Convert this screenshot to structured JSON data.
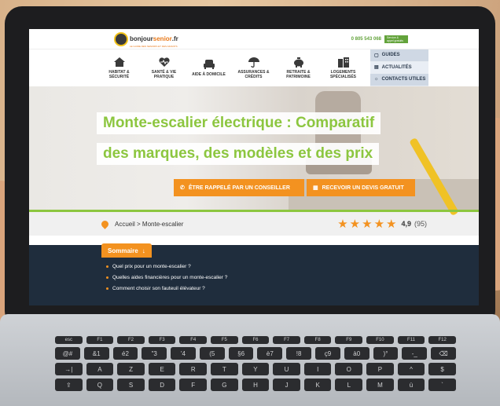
{
  "site": {
    "logo_name": "bonjour",
    "logo_name_accent": "senior",
    "logo_tld": ".fr",
    "logo_tagline": "LE GUIDE DES SENIORS ET DES AIDANTS",
    "phone": "0 805 543 068",
    "phone_badge": "Service & appel gratuits"
  },
  "nav": [
    {
      "label": "HABITAT & SÉCURITÉ",
      "icon": "house-icon"
    },
    {
      "label": "SANTÉ & VIE PRATIQUE",
      "icon": "heart-pulse-icon"
    },
    {
      "label": "AIDE À DOMICILE",
      "icon": "armchair-icon"
    },
    {
      "label": "ASSURANCES & CRÉDITS",
      "icon": "umbrella-icon"
    },
    {
      "label": "RETRAITE & PATRIMOINE",
      "icon": "piggy-bank-icon"
    },
    {
      "label": "LOGEMENTS SPÉCIALISÉS",
      "icon": "building-icon"
    }
  ],
  "side_menu": [
    {
      "label": "GUIDES",
      "icon": "book-icon"
    },
    {
      "label": "ACTUALITÉS",
      "icon": "newspaper-icon"
    },
    {
      "label": "CONTACTS UTILES",
      "icon": "lightbulb-icon"
    }
  ],
  "hero": {
    "title_line1": "Monte-escalier électrique : Comparatif",
    "title_line2": "des marques, des modèles et des prix",
    "cta_callback": "ÊTRE RAPPELÉ PAR UN CONSEILLER",
    "cta_quote": "RECEVOIR UN DEVIS GRATUIT"
  },
  "breadcrumb": {
    "text": "Accueil > Monte-escalier"
  },
  "rating": {
    "value": 4.9,
    "display": "4,9",
    "count": "(95)",
    "stars": 5
  },
  "summary": {
    "tab_label": "Sommaire",
    "items": [
      "Quel prix pour un monte-escalier ?",
      "Quelles aides financières pour un monte-escalier ?",
      "Comment choisir son fauteuil élévateur ?"
    ]
  },
  "keyboard": {
    "fn_row": [
      "esc",
      "F1",
      "F2",
      "F3",
      "F4",
      "F5",
      "F6",
      "F7",
      "F8",
      "F9",
      "F10",
      "F11",
      "F12"
    ],
    "num_row": [
      "@#",
      "&1",
      "é2",
      "\"3",
      "'4",
      "(5",
      "§6",
      "è7",
      "!8",
      "ç9",
      "à0",
      ")°",
      "-_",
      "⌫"
    ],
    "row_a": [
      "→|",
      "A",
      "Z",
      "E",
      "R",
      "T",
      "Y",
      "U",
      "I",
      "O",
      "P",
      "^",
      "$"
    ],
    "row_q": [
      "⇪",
      "Q",
      "S",
      "D",
      "F",
      "G",
      "H",
      "J",
      "K",
      "L",
      "M",
      "ù",
      "`"
    ]
  },
  "colors": {
    "brand_green": "#8cc63f",
    "accent_orange": "#f39220",
    "navy": "#1f2d3d"
  }
}
